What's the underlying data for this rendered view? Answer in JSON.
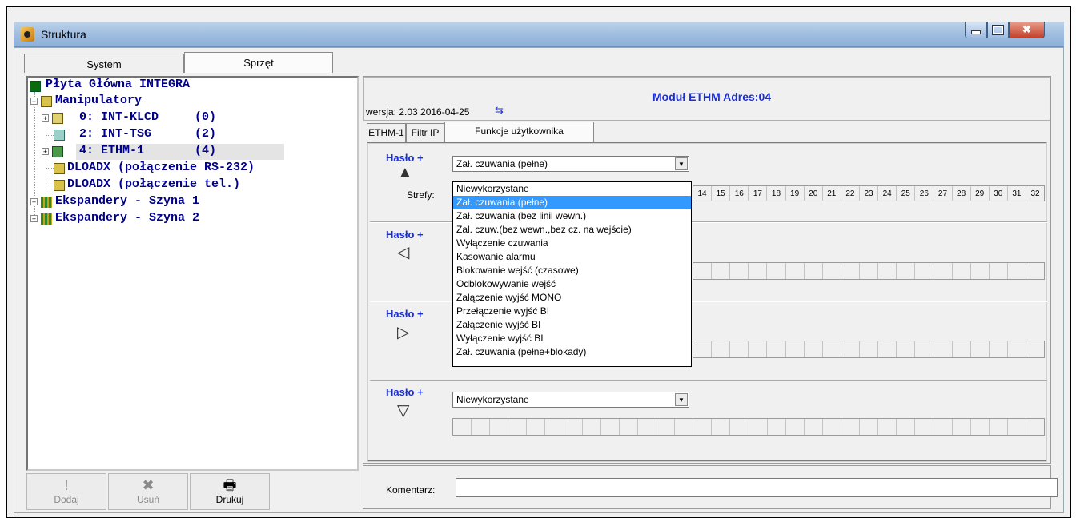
{
  "window": {
    "title": "Struktura",
    "close_glyph": "✖"
  },
  "tabs": {
    "system": "System",
    "sprzet": "Sprzęt"
  },
  "tree": {
    "root": "Płyta Główna INTEGRA",
    "manipulatory": "Manipulatory",
    "items": [
      {
        "text": "0: INT-KLCD     (0)"
      },
      {
        "text": "2: INT-TSG      (2)"
      },
      {
        "text": "4: ETHM-1       (4)"
      }
    ],
    "dloadx_rs": "DLOADX (połączenie RS-232)",
    "dloadx_tel": "DLOADX (połączenie tel.)",
    "exp1": "Ekspandery - Szyna 1",
    "exp2": "Ekspandery - Szyna 2",
    "expand_plus": "+",
    "expand_minus": "−"
  },
  "toolbar": {
    "add": "Dodaj",
    "remove": "Usuń",
    "print": "Drukuj",
    "add_icon": "!",
    "remove_icon": "✖",
    "print_icon": "🖶"
  },
  "module": {
    "title": "Moduł ETHM Adres:04",
    "version": "wersja: 2.03 2016-04-25",
    "refresh_icon": "⇆"
  },
  "inner_tabs": {
    "ethm": "ETHM-1",
    "filtr": "Filtr IP",
    "funkcje": "Funkcje użytkownika"
  },
  "groups": [
    {
      "label": "Hasło +",
      "arrow": "up",
      "arrow_glyph": "▲",
      "combo": "Zał. czuwania (pełne)"
    },
    {
      "label": "Hasło +",
      "arrow": "left",
      "arrow_glyph": "◁"
    },
    {
      "label": "Hasło +",
      "arrow": "right",
      "arrow_glyph": "▷"
    },
    {
      "label": "Hasło +",
      "arrow": "down",
      "arrow_glyph": "▽",
      "combo": "Niewykorzystane"
    }
  ],
  "strefy_label": "Strefy:",
  "zone_numbers": [
    "14",
    "15",
    "16",
    "17",
    "18",
    "19",
    "20",
    "21",
    "22",
    "23",
    "24",
    "25",
    "26",
    "27",
    "28",
    "29",
    "30",
    "31",
    "32"
  ],
  "dropdown": {
    "options": [
      "Niewykorzystane",
      "Zał. czuwania (pełne)",
      "Zał. czuwania (bez linii wewn.)",
      "Zał. czuw.(bez wewn.,bez cz. na wejście)",
      "Wyłączenie czuwania",
      "Kasowanie alarmu",
      "Blokowanie wejść (czasowe)",
      "Odblokowywanie wejść",
      "Załączenie wyjść MONO",
      "Przełączenie wyjść BI",
      "Załączenie wyjść BI",
      "Wyłączenie wyjść BI",
      "Zał. czuwania (pełne+blokady)"
    ],
    "selected_index": 1
  },
  "comment": {
    "label": "Komentarz:",
    "value": ""
  },
  "colors": {
    "accent": "#1a2fd6",
    "tree_text": "#00008b",
    "selection": "#3399ff"
  }
}
